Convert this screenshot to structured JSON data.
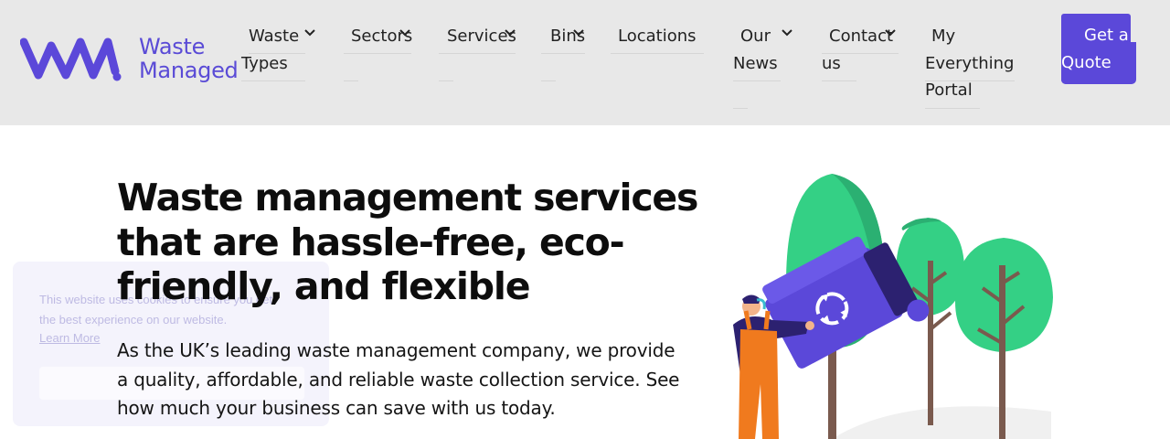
{
  "header": {
    "logo": {
      "line1": "Waste",
      "line2": "Managed",
      "brand_color": "#5b48d9"
    },
    "nav": [
      {
        "id": "waste-types",
        "line1": "Waste",
        "line2": "Types",
        "has_chevron": true
      },
      {
        "id": "sectors",
        "line1": "Sectors",
        "has_chevron": true
      },
      {
        "id": "services",
        "line1": "Services",
        "has_chevron": true
      },
      {
        "id": "bins",
        "line1": "Bins",
        "has_chevron": true
      },
      {
        "id": "locations",
        "line1": "Locations",
        "has_chevron": false
      },
      {
        "id": "our-news",
        "line1": "Our",
        "line2": "News",
        "has_chevron": true
      },
      {
        "id": "contact-us",
        "line1": "Contact",
        "line2": "us",
        "has_chevron": true
      },
      {
        "id": "portal",
        "line1": "My",
        "line2": "Everything",
        "line3": "Portal",
        "has_chevron": false
      }
    ],
    "cta": {
      "line1": "Get a",
      "line2": "Quote"
    },
    "background": "#e8e8e8"
  },
  "hero": {
    "title_lines": [
      "Waste management services",
      "that are hassle-free, eco-",
      "friendly, and flexible"
    ],
    "subtitle_lines": [
      "As the UK’s leading waste management company, we provide",
      "a quality, affordable, and reliable waste collection service. See",
      "how much your business can save with us today."
    ]
  },
  "cookie_banner": {
    "line1": "This website uses cookies to ensure you get",
    "line2": "the best experience on our website.",
    "link": "Learn More"
  },
  "illustration": {
    "subject": "worker-tipping-recycling-bin",
    "colors": {
      "tree": "#34d085",
      "tree_dark": "#2bb072",
      "bin": "#5b48d9",
      "bin_dark": "#2c2170",
      "overalls": "#f07a1e",
      "trunk": "#7a5a4e"
    }
  }
}
